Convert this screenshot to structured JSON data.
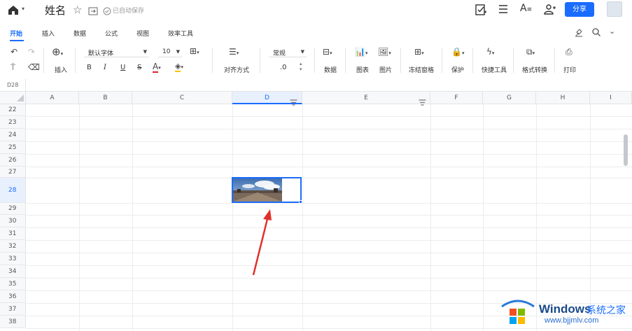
{
  "title_bar": {
    "doc_title": "姓名",
    "autosave_text": "已自动保存",
    "share_label": "分享"
  },
  "ribbon_tabs": [
    "开始",
    "插入",
    "数据",
    "公式",
    "视图",
    "效率工具"
  ],
  "toolbar": {
    "insert_label": "插入",
    "font_name": "默认字体",
    "font_size": "10",
    "bold": "B",
    "italic": "I",
    "underline": "U",
    "strike": "S",
    "align_label": "对齐方式",
    "number_format": "常规",
    "decimal": ".0",
    "data_label": "数据",
    "chart_label": "图表",
    "picture_label": "图片",
    "freeze_label": "冻结窗格",
    "protect_label": "保护",
    "quick_tools_label": "快捷工具",
    "format_convert_label": "格式转换",
    "print_label": "打印"
  },
  "name_box": "D28",
  "columns": [
    "A",
    "B",
    "C",
    "D",
    "E",
    "F",
    "G",
    "H",
    "I"
  ],
  "rows": [
    "22",
    "23",
    "24",
    "25",
    "26",
    "27",
    "28",
    "29",
    "30",
    "31",
    "32",
    "33",
    "34",
    "35",
    "36",
    "37",
    "38"
  ],
  "selected_cell": "D28",
  "watermark": {
    "brand": "Windows",
    "cn": "系统之家",
    "url": "www.bjjmlv.com"
  },
  "colors": {
    "accent": "#1a6cff",
    "arrow": "#e0302a"
  }
}
